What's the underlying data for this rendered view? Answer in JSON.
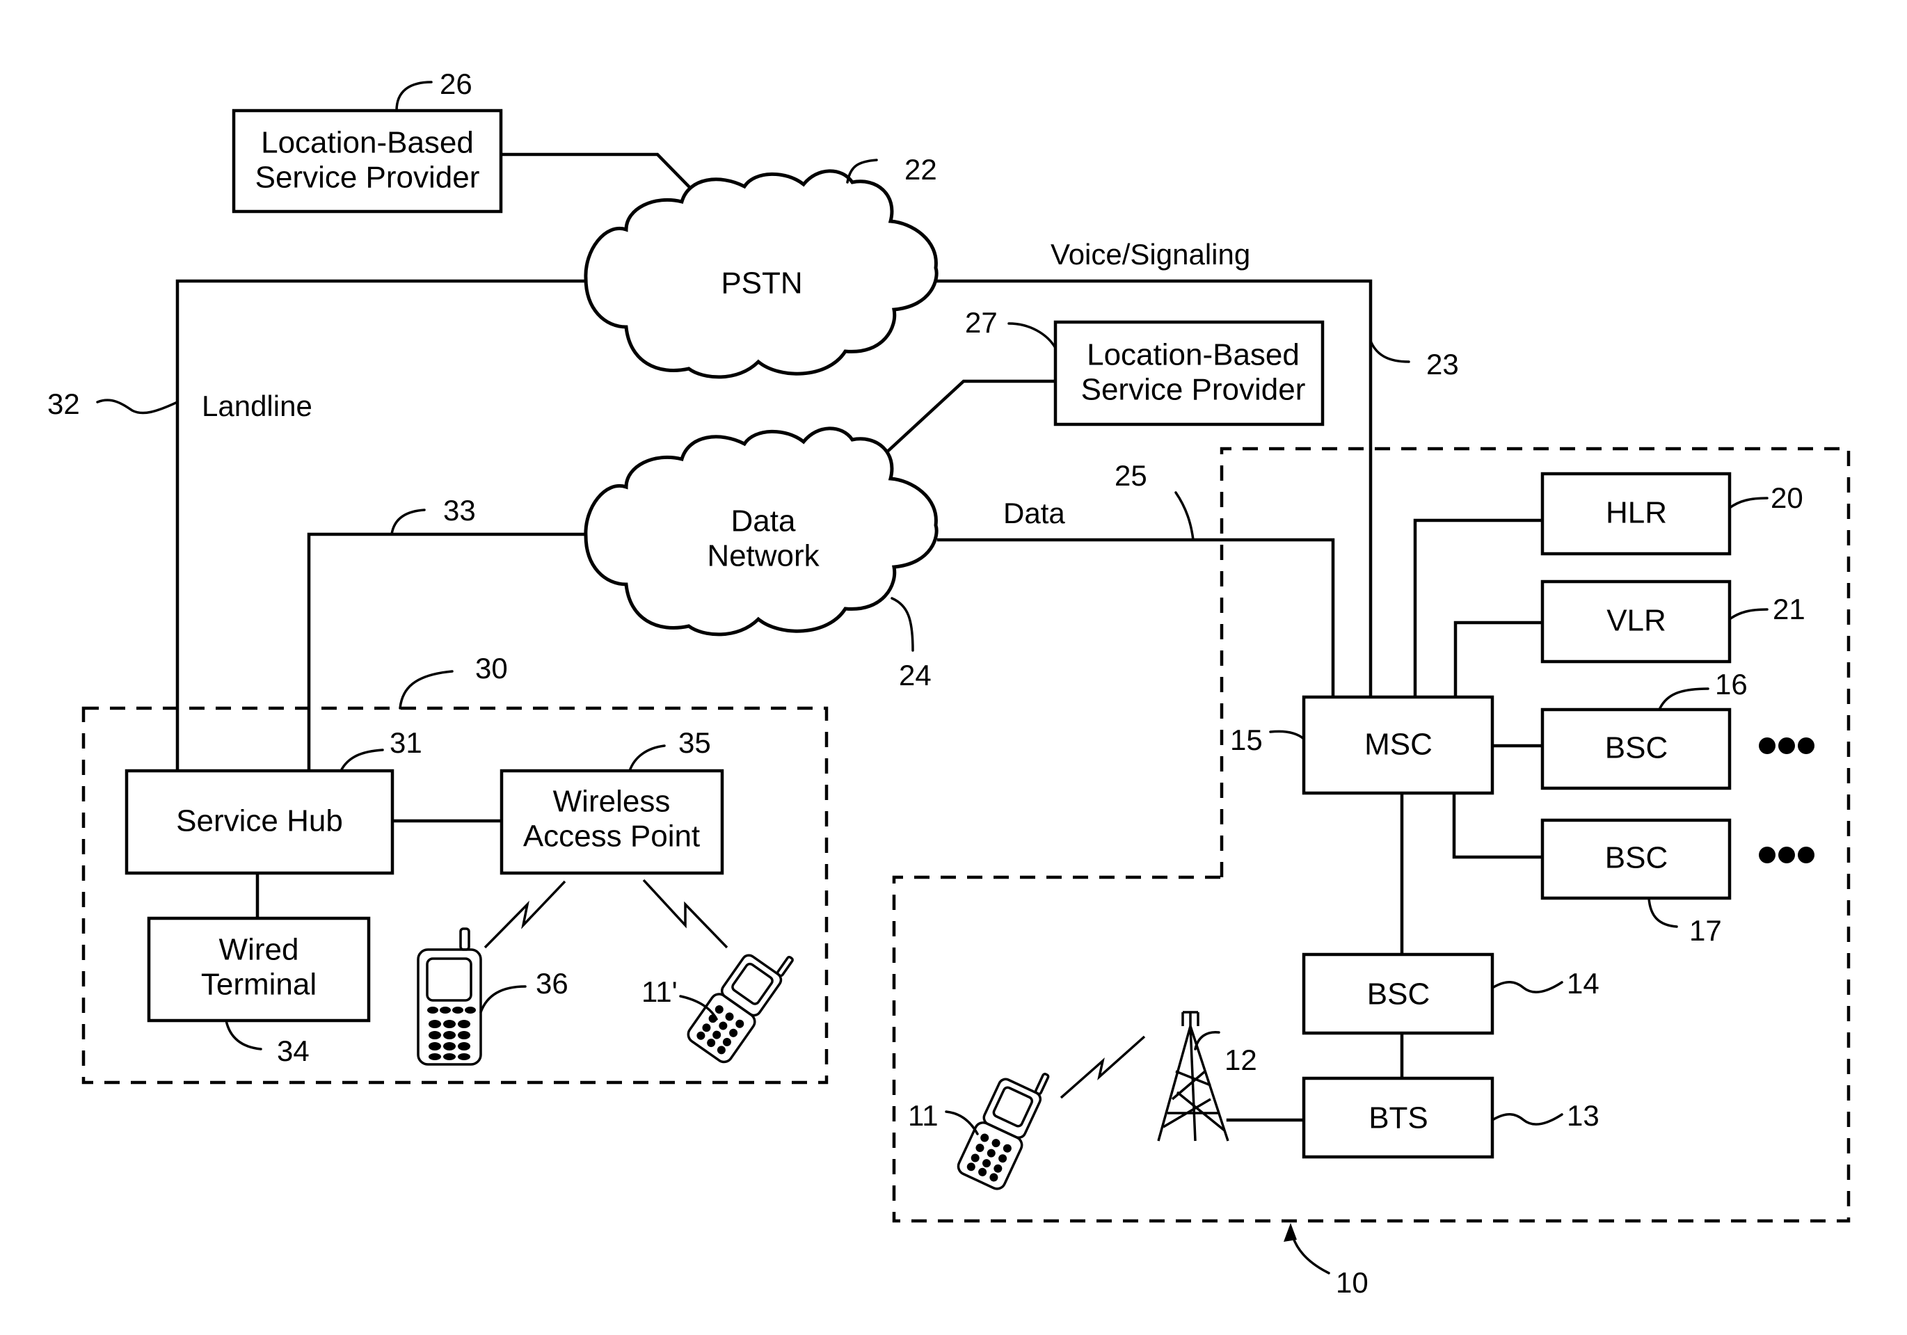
{
  "figure": {
    "nodes": {
      "lbsp_26": {
        "line1": "Location-Based",
        "line2": "Service Provider",
        "ref": "26"
      },
      "pstn": {
        "label": "PSTN",
        "ref": "22"
      },
      "lbsp_27": {
        "line1": "Location-Based",
        "line2": "Service Provider",
        "ref": "27"
      },
      "data_network": {
        "line1": "Data",
        "line2": "Network",
        "ref": "24"
      },
      "hlr": {
        "label": "HLR",
        "ref": "20"
      },
      "vlr": {
        "label": "VLR",
        "ref": "21"
      },
      "msc": {
        "label": "MSC",
        "ref": "15"
      },
      "bsc_16": {
        "label": "BSC",
        "ref": "16"
      },
      "bsc_17": {
        "label": "BSC",
        "ref": "17"
      },
      "bsc_14": {
        "label": "BSC",
        "ref": "14"
      },
      "bts": {
        "label": "BTS",
        "ref": "13"
      },
      "tower": {
        "ref": "12"
      },
      "mobile_11": {
        "ref": "11"
      },
      "service_hub": {
        "label": "Service Hub",
        "ref": "31"
      },
      "wireless_ap": {
        "line1": "Wireless",
        "line2": "Access Point",
        "ref": "35"
      },
      "wired_terminal": {
        "line1": "Wired",
        "line2": "Terminal",
        "ref": "34"
      },
      "phone_36": {
        "ref": "36"
      },
      "mobile_11_prime": {
        "ref": "11'"
      }
    },
    "links": {
      "voice_signaling": {
        "label": "Voice/Signaling",
        "ref": "23"
      },
      "data": {
        "label": "Data",
        "ref": "25"
      },
      "landline": {
        "label": "Landline",
        "ref": "32"
      },
      "hub_data": {
        "ref": "33"
      }
    },
    "regions": {
      "wireless_network": {
        "ref": "10"
      },
      "premises": {
        "ref": "30"
      }
    }
  }
}
